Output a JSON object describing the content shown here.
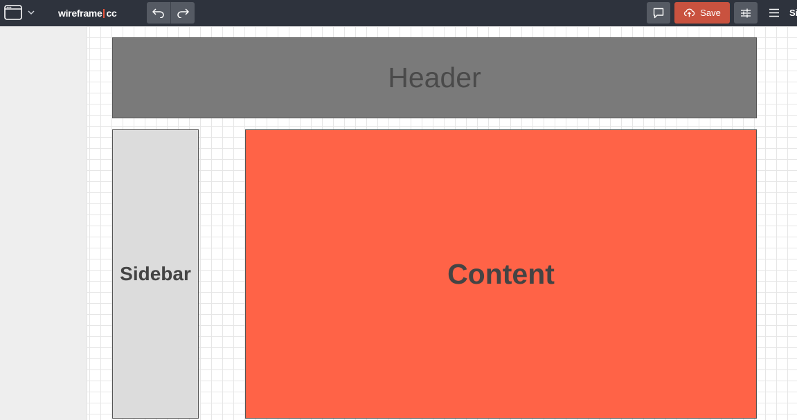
{
  "app": {
    "logo_left": "wireframe",
    "logo_right": "cc"
  },
  "toolbar": {
    "window_icon": "browser-window-icon",
    "dropdown_icon": "chevron-down-icon",
    "undo_icon": "undo-icon",
    "redo_icon": "redo-icon",
    "comment_icon": "comment-icon",
    "save_label": "Save",
    "save_icon": "cloud-upload-icon",
    "settings_icon": "sliders-icon",
    "menu_icon": "hamburger-menu-icon",
    "truncated_label": "Si"
  },
  "canvas": {
    "blocks": {
      "header": "Header",
      "sidebar": "Sidebar",
      "content": "Content"
    }
  },
  "colors": {
    "topbar": "#2e333d",
    "save_button": "#c9523f",
    "header_fill": "#7a7a7a",
    "sidebar_fill": "#dcdcdc",
    "content_fill": "#ff6347"
  }
}
